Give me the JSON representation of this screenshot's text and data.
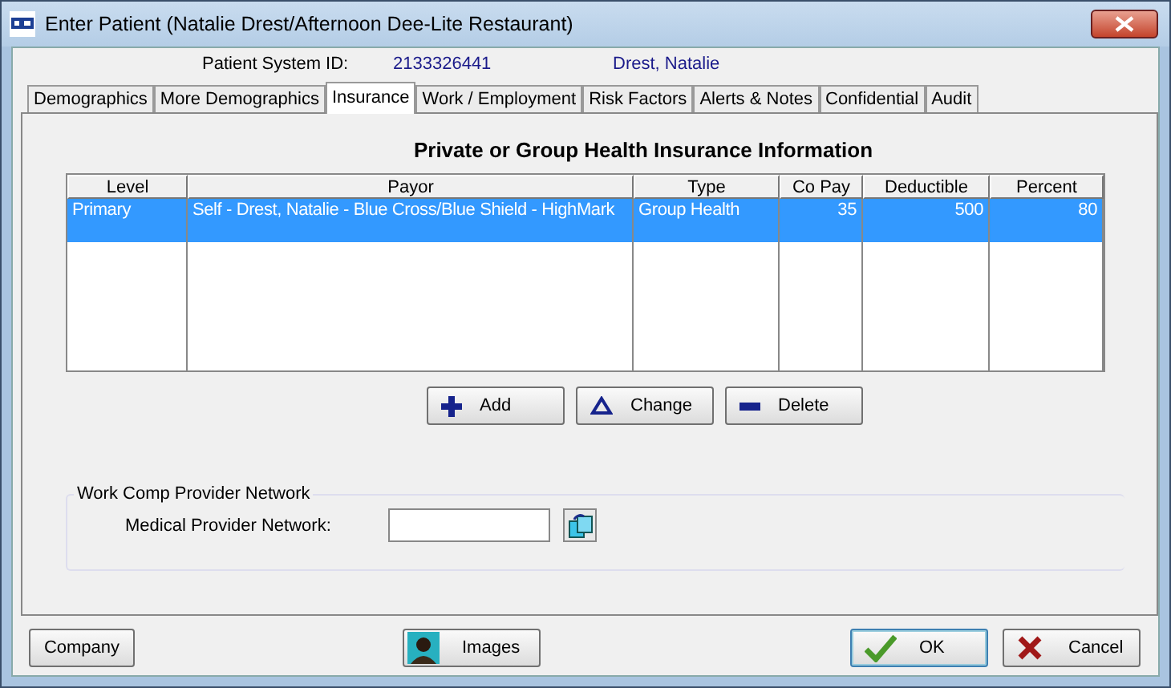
{
  "window": {
    "title": "Enter Patient (Natalie Drest/Afternoon Dee-Lite Restaurant)"
  },
  "patient": {
    "label": "Patient System ID:",
    "id": "2133326441",
    "name": "Drest, Natalie"
  },
  "tabs": [
    {
      "label": "Demographics",
      "selected": false
    },
    {
      "label": "More Demographics",
      "selected": false
    },
    {
      "label": "Insurance",
      "selected": true
    },
    {
      "label": "Work / Employment",
      "selected": false
    },
    {
      "label": "Risk Factors",
      "selected": false
    },
    {
      "label": "Alerts & Notes",
      "selected": false
    },
    {
      "label": "Confidential",
      "selected": false
    },
    {
      "label": "Audit",
      "selected": false
    }
  ],
  "insurance": {
    "title": "Private or Group Health Insurance Information",
    "columns": [
      "Level",
      "Payor",
      "Type",
      "Co Pay",
      "Deductible",
      "Percent"
    ],
    "rows": [
      {
        "cells": [
          "Primary",
          "Self - Drest, Natalie - Blue Cross/Blue Shield - HighMark",
          "Group Health",
          "35",
          "500",
          "80"
        ],
        "selected": true
      }
    ],
    "buttons": [
      {
        "label": "Add",
        "kind": "add"
      },
      {
        "label": "Change",
        "kind": "change"
      },
      {
        "label": "Delete",
        "kind": "delete"
      }
    ]
  },
  "work_comp": {
    "legend": "Work Comp Provider Network",
    "label": "Medical Provider Network:"
  },
  "footer_buttons": [
    {
      "label": "Company",
      "kind": "plain"
    },
    {
      "label": "Images",
      "kind": "images"
    },
    {
      "label": "OK",
      "kind": "ok"
    },
    {
      "label": "Cancel",
      "kind": "cancel"
    }
  ]
}
